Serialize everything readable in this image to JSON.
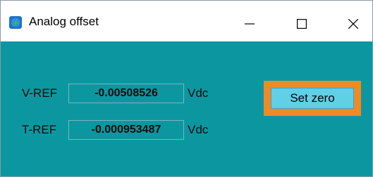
{
  "window": {
    "title": "Analog offset",
    "icon": "app-lightning-icon",
    "controls": [
      "minimize-icon",
      "maximize-icon",
      "close-icon"
    ]
  },
  "rows": [
    {
      "label": "V-REF",
      "value": "-0.00508526",
      "unit": "Vdc"
    },
    {
      "label": "T-REF",
      "value": "-0.000953487",
      "unit": "Vdc"
    }
  ],
  "actions": {
    "set_zero_label": "Set zero"
  },
  "colors": {
    "client_background": "#0c97a0",
    "focus_outline": "#f08a24",
    "button_face": "#5fd0e6"
  }
}
